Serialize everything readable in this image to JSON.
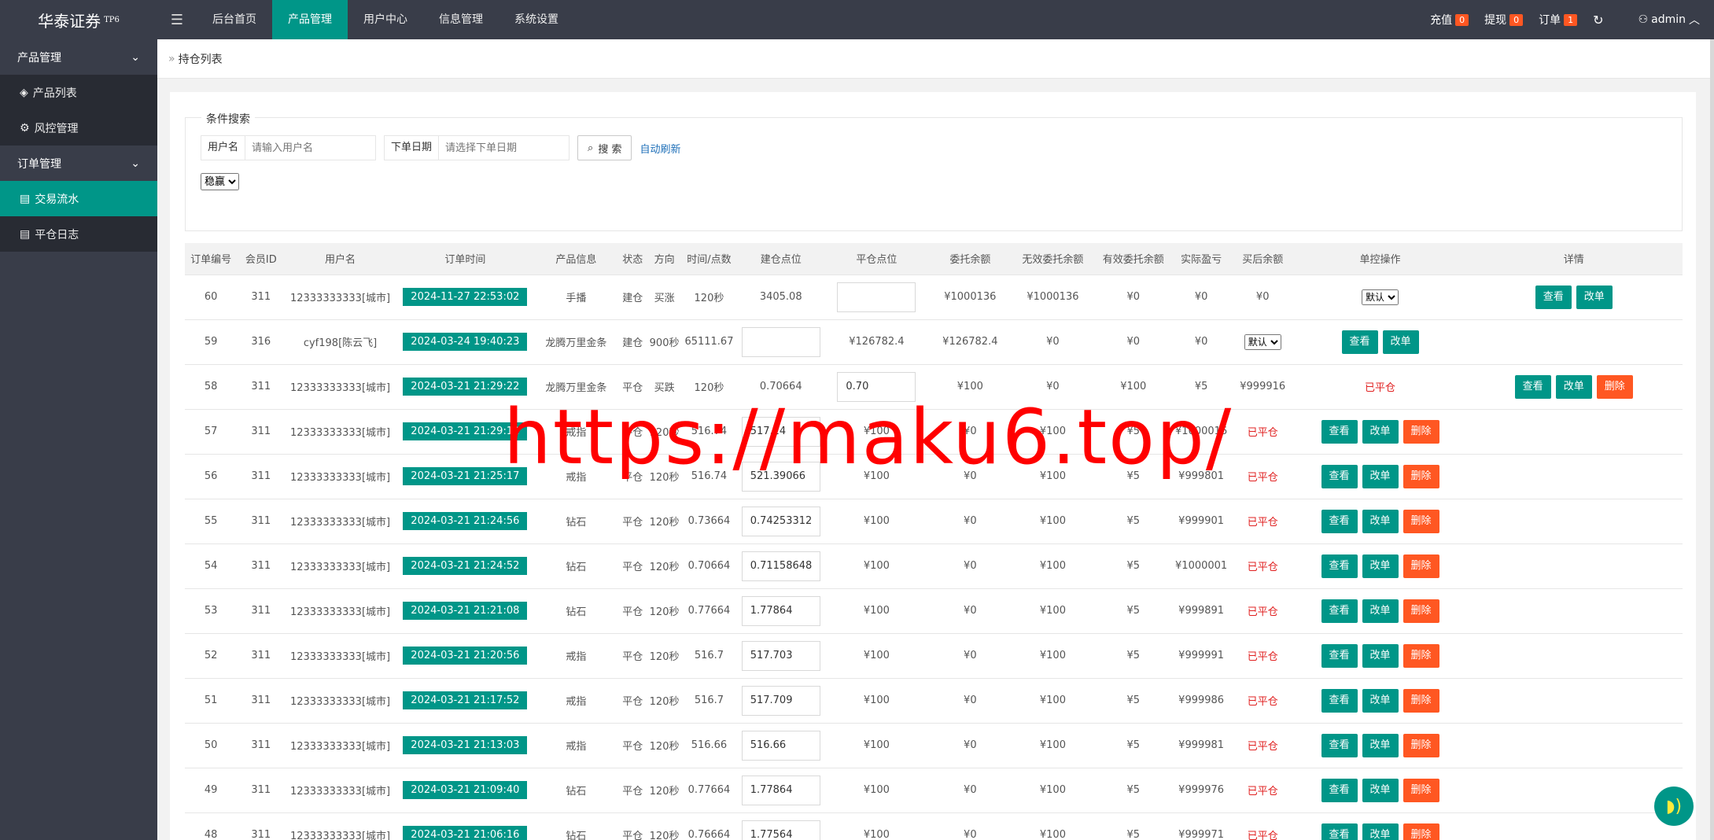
{
  "header": {
    "logo": "华泰证券",
    "logo_sup": "TP6",
    "nav": [
      {
        "label": "后台首页",
        "active": false
      },
      {
        "label": "产品管理",
        "active": true
      },
      {
        "label": "用户中心",
        "active": false
      },
      {
        "label": "信息管理",
        "active": false
      },
      {
        "label": "系统设置",
        "active": false
      }
    ],
    "recharge_label": "充值",
    "recharge_count": "0",
    "withdraw_label": "提现",
    "withdraw_count": "0",
    "order_label": "订单",
    "order_count": "1",
    "user": "admin"
  },
  "sidebar": {
    "group1": "产品管理",
    "item_product_list": "产品列表",
    "item_risk": "风控管理",
    "group2": "订单管理",
    "item_trade_flow": "交易流水",
    "item_close_log": "平仓日志"
  },
  "breadcrumb": "持仓列表",
  "search": {
    "legend": "条件搜索",
    "username_label": "用户名",
    "username_placeholder": "请输入用户名",
    "date_label": "下单日期",
    "date_placeholder": "请选择下单日期",
    "search_button": "搜 索",
    "auto_refresh": "自动刷新",
    "filter_select": "稳赢"
  },
  "table": {
    "headers": [
      "订单编号",
      "会员ID",
      "用户名",
      "订单时间",
      "产品信息",
      "状态",
      "方向",
      "时间/点数",
      "建仓点位",
      "平仓点位",
      "委托余额",
      "无效委托余额",
      "有效委托余额",
      "实际盈亏",
      "买后余额",
      "单控操作",
      "详情"
    ],
    "btn_view": "查看",
    "btn_edit": "改单",
    "btn_delete": "删除",
    "select_default": "默认",
    "closed_label": "已平仓",
    "rows": [
      {
        "id": "60",
        "mid": "311",
        "user": "12333333333[城市]",
        "time": "2024-11-27 22:53:02",
        "product": "手播",
        "status": "建仓",
        "dir": "买涨",
        "dur": "120秒",
        "open": "3405.08",
        "close": "",
        "entrust": "¥1000136",
        "invalid": "¥1000136",
        "valid": "¥0",
        "pnl": "¥0",
        "after": "¥0"
      },
      {
        "id": "59",
        "mid": "316",
        "user": "cyf198[陈云飞]",
        "time": "2024-03-24 19:40:23",
        "product": "龙腾万里金条",
        "status": "建仓",
        "dir": "900秒",
        "dur": "65111.67",
        "open": "",
        "close": "¥126782.4",
        "entrust": "¥126782.4",
        "invalid": "¥0",
        "valid": "¥0",
        "pnl": "¥0",
        "after": ""
      },
      {
        "id": "58",
        "mid": "311",
        "user": "12333333333[城市]",
        "time": "2024-03-21 21:29:22",
        "product": "龙腾万里金条",
        "status": "平仓",
        "dir": "买跌",
        "dur": "120秒",
        "open": "0.70664",
        "close": "0.70",
        "entrust": "¥100",
        "invalid": "¥0",
        "valid": "¥100",
        "pnl": "¥5",
        "after": "¥999916"
      },
      {
        "id": "57",
        "mid": "311",
        "user": "12333333333[城市]",
        "time": "2024-03-21 21:29:12",
        "product": "戒指",
        "status": "平仓",
        "dir": "120秒",
        "dur": "516.74",
        "open": "517.24",
        "close": "¥100",
        "entrust": "¥0",
        "invalid": "¥100",
        "valid": "¥5",
        "pnl": "¥1000016",
        "after": ""
      },
      {
        "id": "56",
        "mid": "311",
        "user": "12333333333[城市]",
        "time": "2024-03-21 21:25:17",
        "product": "戒指",
        "status": "平仓",
        "dir": "120秒",
        "dur": "516.74",
        "open": "521.39066",
        "close": "¥100",
        "entrust": "¥0",
        "invalid": "¥100",
        "valid": "¥5",
        "pnl": "¥999801",
        "after": ""
      },
      {
        "id": "55",
        "mid": "311",
        "user": "12333333333[城市]",
        "time": "2024-03-21 21:24:56",
        "product": "钻石",
        "status": "平仓",
        "dir": "120秒",
        "dur": "0.73664",
        "open": "0.74253312",
        "close": "¥100",
        "entrust": "¥0",
        "invalid": "¥100",
        "valid": "¥5",
        "pnl": "¥999901",
        "after": ""
      },
      {
        "id": "54",
        "mid": "311",
        "user": "12333333333[城市]",
        "time": "2024-03-21 21:24:52",
        "product": "钻石",
        "status": "平仓",
        "dir": "120秒",
        "dur": "0.70664",
        "open": "0.71158648",
        "close": "¥100",
        "entrust": "¥0",
        "invalid": "¥100",
        "valid": "¥5",
        "pnl": "¥1000001",
        "after": ""
      },
      {
        "id": "53",
        "mid": "311",
        "user": "12333333333[城市]",
        "time": "2024-03-21 21:21:08",
        "product": "钻石",
        "status": "平仓",
        "dir": "120秒",
        "dur": "0.77664",
        "open": "1.77864",
        "close": "¥100",
        "entrust": "¥0",
        "invalid": "¥100",
        "valid": "¥5",
        "pnl": "¥999891",
        "after": ""
      },
      {
        "id": "52",
        "mid": "311",
        "user": "12333333333[城市]",
        "time": "2024-03-21 21:20:56",
        "product": "戒指",
        "status": "平仓",
        "dir": "120秒",
        "dur": "516.7",
        "open": "517.703",
        "close": "¥100",
        "entrust": "¥0",
        "invalid": "¥100",
        "valid": "¥5",
        "pnl": "¥999991",
        "after": ""
      },
      {
        "id": "51",
        "mid": "311",
        "user": "12333333333[城市]",
        "time": "2024-03-21 21:17:52",
        "product": "戒指",
        "status": "平仓",
        "dir": "120秒",
        "dur": "516.7",
        "open": "517.709",
        "close": "¥100",
        "entrust": "¥0",
        "invalid": "¥100",
        "valid": "¥5",
        "pnl": "¥999986",
        "after": ""
      },
      {
        "id": "50",
        "mid": "311",
        "user": "12333333333[城市]",
        "time": "2024-03-21 21:13:03",
        "product": "戒指",
        "status": "平仓",
        "dir": "120秒",
        "dur": "516.66",
        "open": "516.66",
        "close": "¥100",
        "entrust": "¥0",
        "invalid": "¥100",
        "valid": "¥5",
        "pnl": "¥999981",
        "after": ""
      },
      {
        "id": "49",
        "mid": "311",
        "user": "12333333333[城市]",
        "time": "2024-03-21 21:09:40",
        "product": "钻石",
        "status": "平仓",
        "dir": "120秒",
        "dur": "0.77664",
        "open": "1.77864",
        "close": "¥100",
        "entrust": "¥0",
        "invalid": "¥100",
        "valid": "¥5",
        "pnl": "¥999976",
        "after": ""
      },
      {
        "id": "48",
        "mid": "311",
        "user": "12333333333[城市]",
        "time": "2024-03-21 21:06:16",
        "product": "钻石",
        "status": "平仓",
        "dir": "120秒",
        "dur": "0.76664",
        "open": "1.77564",
        "close": "¥100",
        "entrust": "¥0",
        "invalid": "¥100",
        "valid": "¥5",
        "pnl": "¥999971",
        "after": ""
      }
    ]
  },
  "watermark": "https://maku6.top/"
}
